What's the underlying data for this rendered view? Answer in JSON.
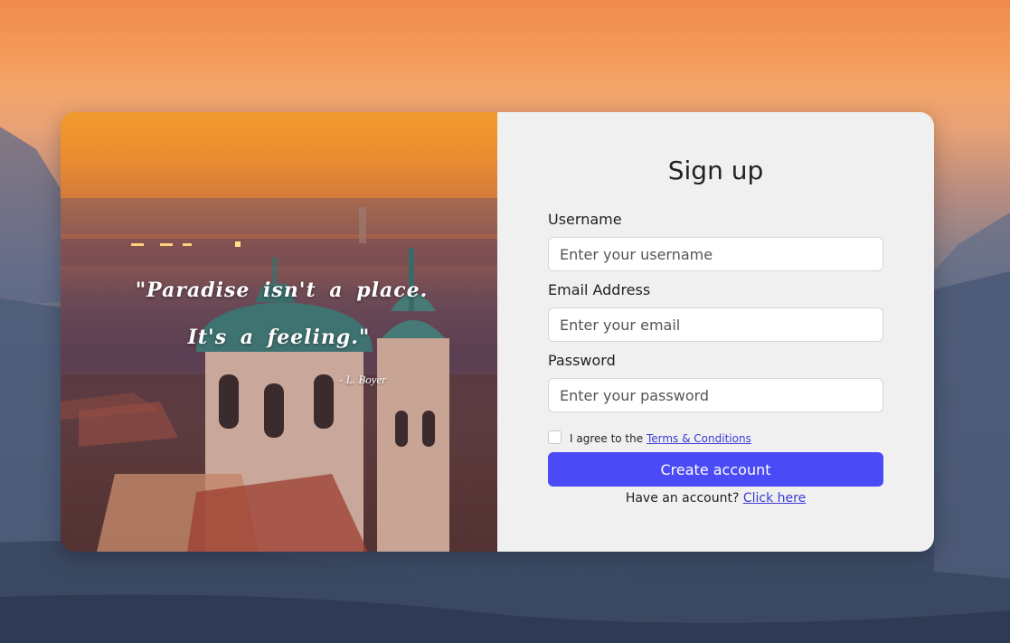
{
  "quote": {
    "line1": "\"Paradise isn't a place.",
    "line2": "It's a feeling.\"",
    "author": "- L. Boyer"
  },
  "form": {
    "title": "Sign up",
    "username": {
      "label": "Username",
      "placeholder": "Enter your username",
      "value": ""
    },
    "email": {
      "label": "Email Address",
      "placeholder": "Enter your email",
      "value": ""
    },
    "password": {
      "label": "Password",
      "placeholder": "Enter your password",
      "value": ""
    },
    "agree_prefix": "I agree to the",
    "terms_link": "Terms & Conditions",
    "agree_checked": false,
    "submit_label": "Create account",
    "have_account": "Have an account?",
    "login_link": "Click here"
  },
  "colors": {
    "accent": "#4a4af7",
    "link": "#3b3bd6",
    "panel_bg": "#f0f0f0"
  }
}
